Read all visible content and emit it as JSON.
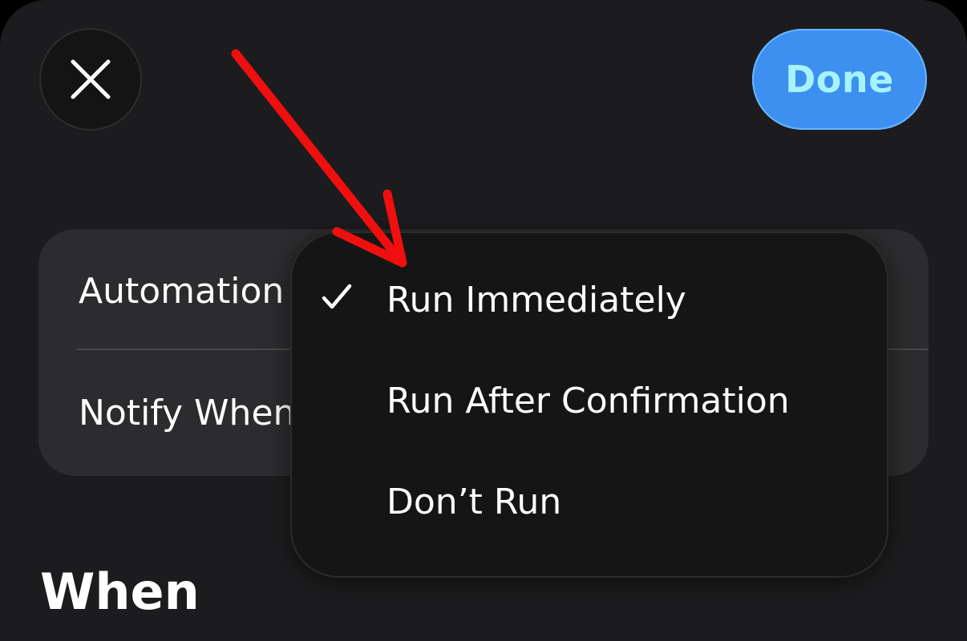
{
  "header": {
    "close_icon": "close-icon",
    "done_label": "Done"
  },
  "settings": {
    "rows": [
      {
        "label": "Automation"
      },
      {
        "label": "Notify When"
      }
    ]
  },
  "menu": {
    "items": [
      {
        "label": "Run Immediately",
        "selected": true
      },
      {
        "label": "Run After Confirmation",
        "selected": false
      },
      {
        "label": "Don’t Run",
        "selected": false
      }
    ]
  },
  "section": {
    "title": "When"
  },
  "annotation": {
    "arrow_color": "#f00f0f"
  },
  "colors": {
    "accent": "#3d8ff0",
    "done_text": "#a6f3ff",
    "sheet_bg": "#1c1c1e",
    "card_bg": "#2c2c2e",
    "menu_bg": "#151515"
  }
}
